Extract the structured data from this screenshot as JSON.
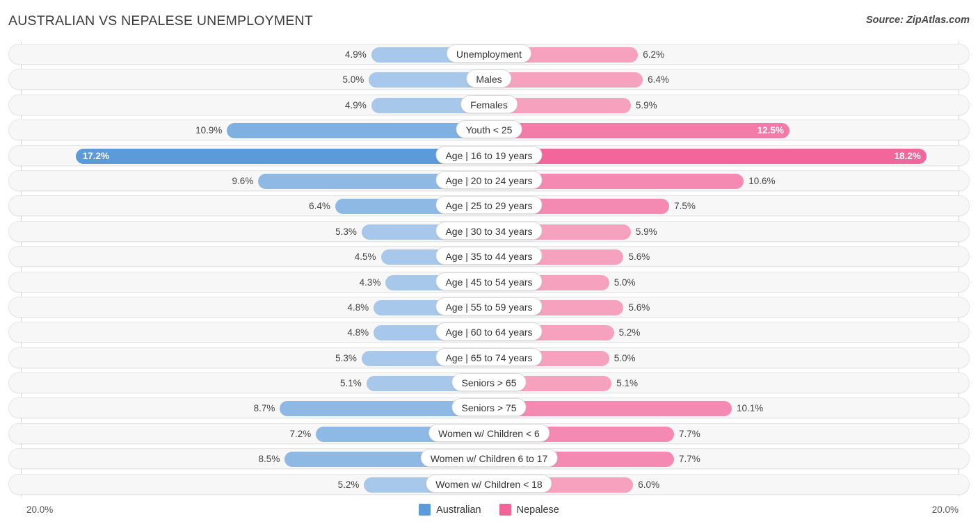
{
  "header": {
    "title": "AUSTRALIAN VS NEPALESE UNEMPLOYMENT",
    "source": "Source: ZipAtlas.com"
  },
  "axis": {
    "left_tick": "20.0%",
    "right_tick": "20.0%",
    "max": 20.0
  },
  "legend": [
    {
      "label": "Australian",
      "color": "#5b9bd9"
    },
    {
      "label": "Nepalese",
      "color": "#f0649a"
    }
  ],
  "colors": {
    "australian_light": "#a7c8ea",
    "australian_strong": "#5b9bd9",
    "nepalese_light": "#f6a2bf",
    "nepalese_strong": "#f2669b",
    "track": "#f7f7f7",
    "axis_line": "#d4d4d4"
  },
  "chart_data": {
    "type": "bar",
    "orientation": "horizontal-diverging",
    "title": "AUSTRALIAN VS NEPALESE UNEMPLOYMENT",
    "xlabel": "",
    "ylabel": "",
    "xlim": [
      20.0,
      20.0
    ],
    "grid": false,
    "legend_position": "bottom-center",
    "categories": [
      "Unemployment",
      "Males",
      "Females",
      "Youth < 25",
      "Age | 16 to 19 years",
      "Age | 20 to 24 years",
      "Age | 25 to 29 years",
      "Age | 30 to 34 years",
      "Age | 35 to 44 years",
      "Age | 45 to 54 years",
      "Age | 55 to 59 years",
      "Age | 60 to 64 years",
      "Age | 65 to 74 years",
      "Seniors > 65",
      "Seniors > 75",
      "Women w/ Children < 6",
      "Women w/ Children 6 to 17",
      "Women w/ Children < 18"
    ],
    "series": [
      {
        "name": "Australian",
        "values": [
          4.9,
          5.0,
          4.9,
          10.9,
          17.2,
          9.6,
          6.4,
          5.3,
          4.5,
          4.3,
          4.8,
          4.8,
          5.3,
          5.1,
          8.7,
          7.2,
          8.5,
          5.2
        ]
      },
      {
        "name": "Nepalese",
        "values": [
          6.2,
          6.4,
          5.9,
          12.5,
          18.2,
          10.6,
          7.5,
          5.9,
          5.6,
          5.0,
          5.6,
          5.2,
          5.0,
          5.1,
          10.1,
          7.7,
          7.7,
          6.0
        ]
      }
    ]
  },
  "rows": [
    {
      "label": "Unemployment",
      "left": "4.9%",
      "right": "6.2%",
      "lv": 4.9,
      "rv": 6.2,
      "style": "normal",
      "left_inside": false,
      "right_inside": false
    },
    {
      "label": "Males",
      "left": "5.0%",
      "right": "6.4%",
      "lv": 5.0,
      "rv": 6.4,
      "style": "normal",
      "left_inside": false,
      "right_inside": false
    },
    {
      "label": "Females",
      "left": "4.9%",
      "right": "5.9%",
      "lv": 4.9,
      "rv": 5.9,
      "style": "normal",
      "left_inside": false,
      "right_inside": false
    },
    {
      "label": "Youth < 25",
      "left": "10.9%",
      "right": "12.5%",
      "lv": 10.9,
      "rv": 12.5,
      "style": "s1",
      "left_inside": false,
      "right_inside": true
    },
    {
      "label": "Age | 16 to 19 years",
      "left": "17.2%",
      "right": "18.2%",
      "lv": 17.2,
      "rv": 18.2,
      "style": "hl",
      "left_inside": true,
      "right_inside": true
    },
    {
      "label": "Age | 20 to 24 years",
      "left": "9.6%",
      "right": "10.6%",
      "lv": 9.6,
      "rv": 10.6,
      "style": "s2",
      "left_inside": false,
      "right_inside": false
    },
    {
      "label": "Age | 25 to 29 years",
      "left": "6.4%",
      "right": "7.5%",
      "lv": 6.4,
      "rv": 7.5,
      "style": "s2",
      "left_inside": false,
      "right_inside": false
    },
    {
      "label": "Age | 30 to 34 years",
      "left": "5.3%",
      "right": "5.9%",
      "lv": 5.3,
      "rv": 5.9,
      "style": "normal",
      "left_inside": false,
      "right_inside": false
    },
    {
      "label": "Age | 35 to 44 years",
      "left": "4.5%",
      "right": "5.6%",
      "lv": 4.5,
      "rv": 5.6,
      "style": "normal",
      "left_inside": false,
      "right_inside": false
    },
    {
      "label": "Age | 45 to 54 years",
      "left": "4.3%",
      "right": "5.0%",
      "lv": 4.3,
      "rv": 5.0,
      "style": "normal",
      "left_inside": false,
      "right_inside": false
    },
    {
      "label": "Age | 55 to 59 years",
      "left": "4.8%",
      "right": "5.6%",
      "lv": 4.8,
      "rv": 5.6,
      "style": "normal",
      "left_inside": false,
      "right_inside": false
    },
    {
      "label": "Age | 60 to 64 years",
      "left": "4.8%",
      "right": "5.2%",
      "lv": 4.8,
      "rv": 5.2,
      "style": "normal",
      "left_inside": false,
      "right_inside": false
    },
    {
      "label": "Age | 65 to 74 years",
      "left": "5.3%",
      "right": "5.0%",
      "lv": 5.3,
      "rv": 5.0,
      "style": "normal",
      "left_inside": false,
      "right_inside": false
    },
    {
      "label": "Seniors > 65",
      "left": "5.1%",
      "right": "5.1%",
      "lv": 5.1,
      "rv": 5.1,
      "style": "normal",
      "left_inside": false,
      "right_inside": false
    },
    {
      "label": "Seniors > 75",
      "left": "8.7%",
      "right": "10.1%",
      "lv": 8.7,
      "rv": 10.1,
      "style": "s2",
      "left_inside": false,
      "right_inside": false
    },
    {
      "label": "Women w/ Children < 6",
      "left": "7.2%",
      "right": "7.7%",
      "lv": 7.2,
      "rv": 7.7,
      "style": "s2",
      "left_inside": false,
      "right_inside": false
    },
    {
      "label": "Women w/ Children 6 to 17",
      "left": "8.5%",
      "right": "7.7%",
      "lv": 8.5,
      "rv": 7.7,
      "style": "s2",
      "left_inside": false,
      "right_inside": false
    },
    {
      "label": "Women w/ Children < 18",
      "left": "5.2%",
      "right": "6.0%",
      "lv": 5.2,
      "rv": 6.0,
      "style": "normal",
      "left_inside": false,
      "right_inside": false
    }
  ]
}
